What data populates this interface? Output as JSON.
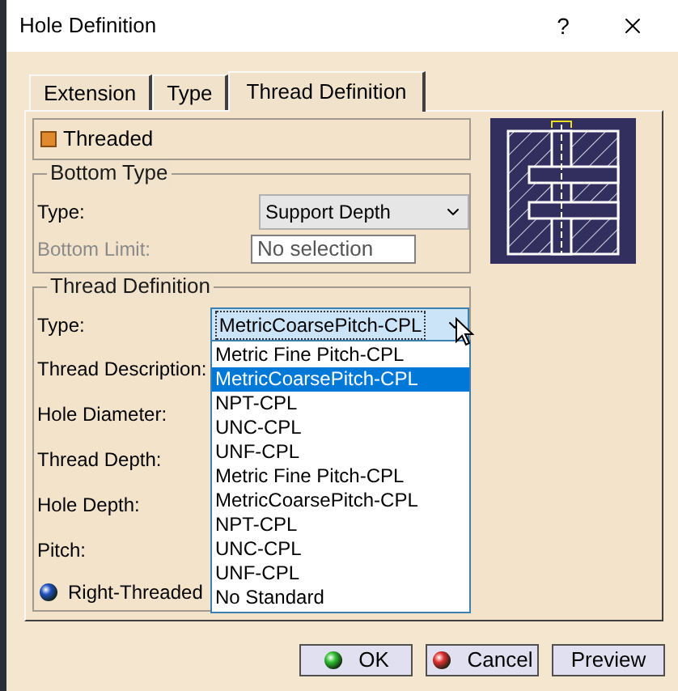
{
  "window": {
    "title": "Hole Definition",
    "help": "?"
  },
  "tabs": [
    {
      "label": "Extension",
      "selected": false
    },
    {
      "label": "Type",
      "selected": false
    },
    {
      "label": "Thread Definition",
      "selected": true
    }
  ],
  "threaded": {
    "label": "Threaded",
    "checked": true
  },
  "bottom_type": {
    "title": "Bottom Type",
    "type_label": "Type:",
    "type_value": "Support Depth",
    "limit_label": "Bottom Limit:",
    "limit_disabled": true,
    "limit_value": "No selection"
  },
  "thread_definition": {
    "title": "Thread Definition",
    "type_label": "Type:",
    "type_value": "MetricCoarsePitch-CPL",
    "labels": [
      "Thread Description:",
      "Hole Diameter:",
      "Thread Depth:",
      "Hole Depth:",
      "Pitch:"
    ],
    "right_threaded": {
      "label": "Right-Threaded",
      "selected": true
    },
    "options": [
      {
        "label": "Metric Fine Pitch-CPL",
        "selected": false
      },
      {
        "label": "MetricCoarsePitch-CPL",
        "selected": true
      },
      {
        "label": "NPT-CPL",
        "selected": false
      },
      {
        "label": "UNC-CPL",
        "selected": false
      },
      {
        "label": "UNF-CPL",
        "selected": false
      },
      {
        "label": "Metric Fine Pitch-CPL",
        "selected": false
      },
      {
        "label": "MetricCoarsePitch-CPL",
        "selected": false
      },
      {
        "label": "NPT-CPL",
        "selected": false
      },
      {
        "label": "UNC-CPL",
        "selected": false
      },
      {
        "label": "UNF-CPL",
        "selected": false
      },
      {
        "label": "No Standard",
        "selected": false
      }
    ]
  },
  "buttons": [
    {
      "label": "OK",
      "kind": "ok"
    },
    {
      "label": "Cancel",
      "kind": "cancel"
    },
    {
      "label": "Preview",
      "kind": "plain"
    }
  ]
}
